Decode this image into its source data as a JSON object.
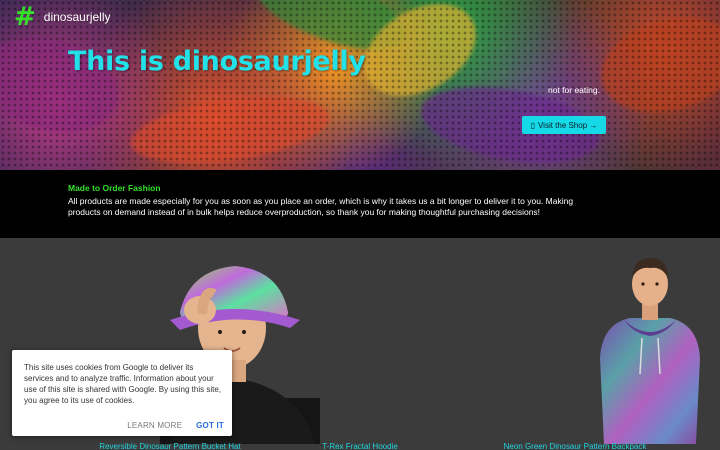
{
  "site": {
    "logo_symbol": "#",
    "logo_text": "dinosaurjelly"
  },
  "hero": {
    "title": "This is dinosaurjelly",
    "tagline": "not for eating.",
    "shop_button": "Visit the Shop →",
    "shop_icon": "shopping-bag-icon"
  },
  "info": {
    "title": "Made to Order Fashion",
    "body": "All products are made especially for you as soon as you place an order, which is why it takes us a bit longer to deliver it to you. Making products on demand instead of in bulk helps reduce overproduction, so thank you for making thoughtful purchasing decisions!"
  },
  "products": [
    {
      "name": "Reversible Dinosaur Pattern Bucket Hat"
    },
    {
      "name": "T-Rex Fractal Hoodie"
    },
    {
      "name": "Neon Green Dinosaur Pattern Backpack"
    }
  ],
  "cookie": {
    "text": "This site uses cookies from Google to deliver its services and to analyze traffic. Information about your use of this site is shared with Google. By using this site, you agree to its use of cookies.",
    "learn_more": "LEARN MORE",
    "got_it": "GOT IT"
  },
  "colors": {
    "accent_cyan": "#22e1e8",
    "accent_green": "#35e02a",
    "info_bg": "#000000",
    "products_bg": "#3b3b3b"
  }
}
